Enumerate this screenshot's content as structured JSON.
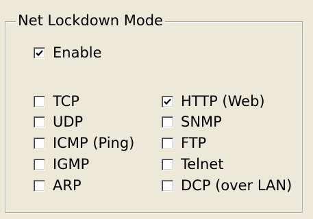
{
  "group": {
    "title": "Net Lockdown Mode"
  },
  "enable": {
    "label": "Enable",
    "checked": true
  },
  "protocols": {
    "tcp": {
      "label": "TCP",
      "checked": false
    },
    "udp": {
      "label": "UDP",
      "checked": false
    },
    "icmp": {
      "label": "ICMP (Ping)",
      "checked": false
    },
    "igmp": {
      "label": "IGMP",
      "checked": false
    },
    "arp": {
      "label": "ARP",
      "checked": false
    },
    "http": {
      "label": "HTTP (Web)",
      "checked": true
    },
    "snmp": {
      "label": "SNMP",
      "checked": false
    },
    "ftp": {
      "label": "FTP",
      "checked": false
    },
    "telnet": {
      "label": "Telnet",
      "checked": false
    },
    "dcp": {
      "label": "DCP (over LAN)",
      "checked": false
    }
  }
}
